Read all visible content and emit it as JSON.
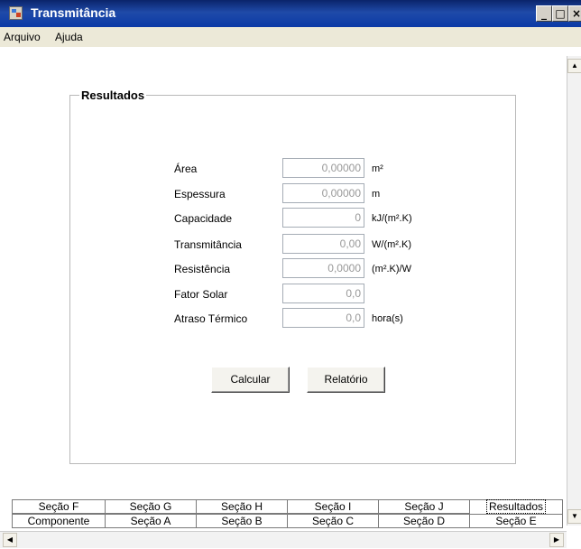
{
  "window": {
    "title": "Transmitância",
    "min_label": "_",
    "max_label": "□",
    "close_label": "×"
  },
  "menu": [
    "Arquivo",
    "Ajuda"
  ],
  "group": {
    "title": "Resultados"
  },
  "fields": [
    {
      "label": "Área",
      "value": "0,00000",
      "unit": "m²"
    },
    {
      "label": "Espessura",
      "value": "0,00000",
      "unit": "m"
    },
    {
      "label": "Capacidade",
      "value": "0",
      "unit": "kJ/(m².K)"
    },
    {
      "label": "Transmitância",
      "value": "0,00",
      "unit": "W/(m².K)"
    },
    {
      "label": "Resistência",
      "value": "0,0000",
      "unit": "(m².K)/W"
    },
    {
      "label": "Fator Solar",
      "value": "0,0",
      "unit": ""
    },
    {
      "label": "Atraso Térmico",
      "value": "0,0",
      "unit": "hora(s)"
    }
  ],
  "buttons": {
    "calcular": "Calcular",
    "relatorio": "Relatório"
  },
  "tabs": {
    "row1": [
      "Seção F",
      "Seção G",
      "Seção H",
      "Seção I",
      "Seção J",
      "Resultados"
    ],
    "row2": [
      "Componente",
      "Seção A",
      "Seção B",
      "Seção C",
      "Seção D",
      "Seção E"
    ],
    "selected": "Resultados"
  },
  "scroll_icons": {
    "up": "▲",
    "down": "▼",
    "left": "◀",
    "right": "▶"
  }
}
